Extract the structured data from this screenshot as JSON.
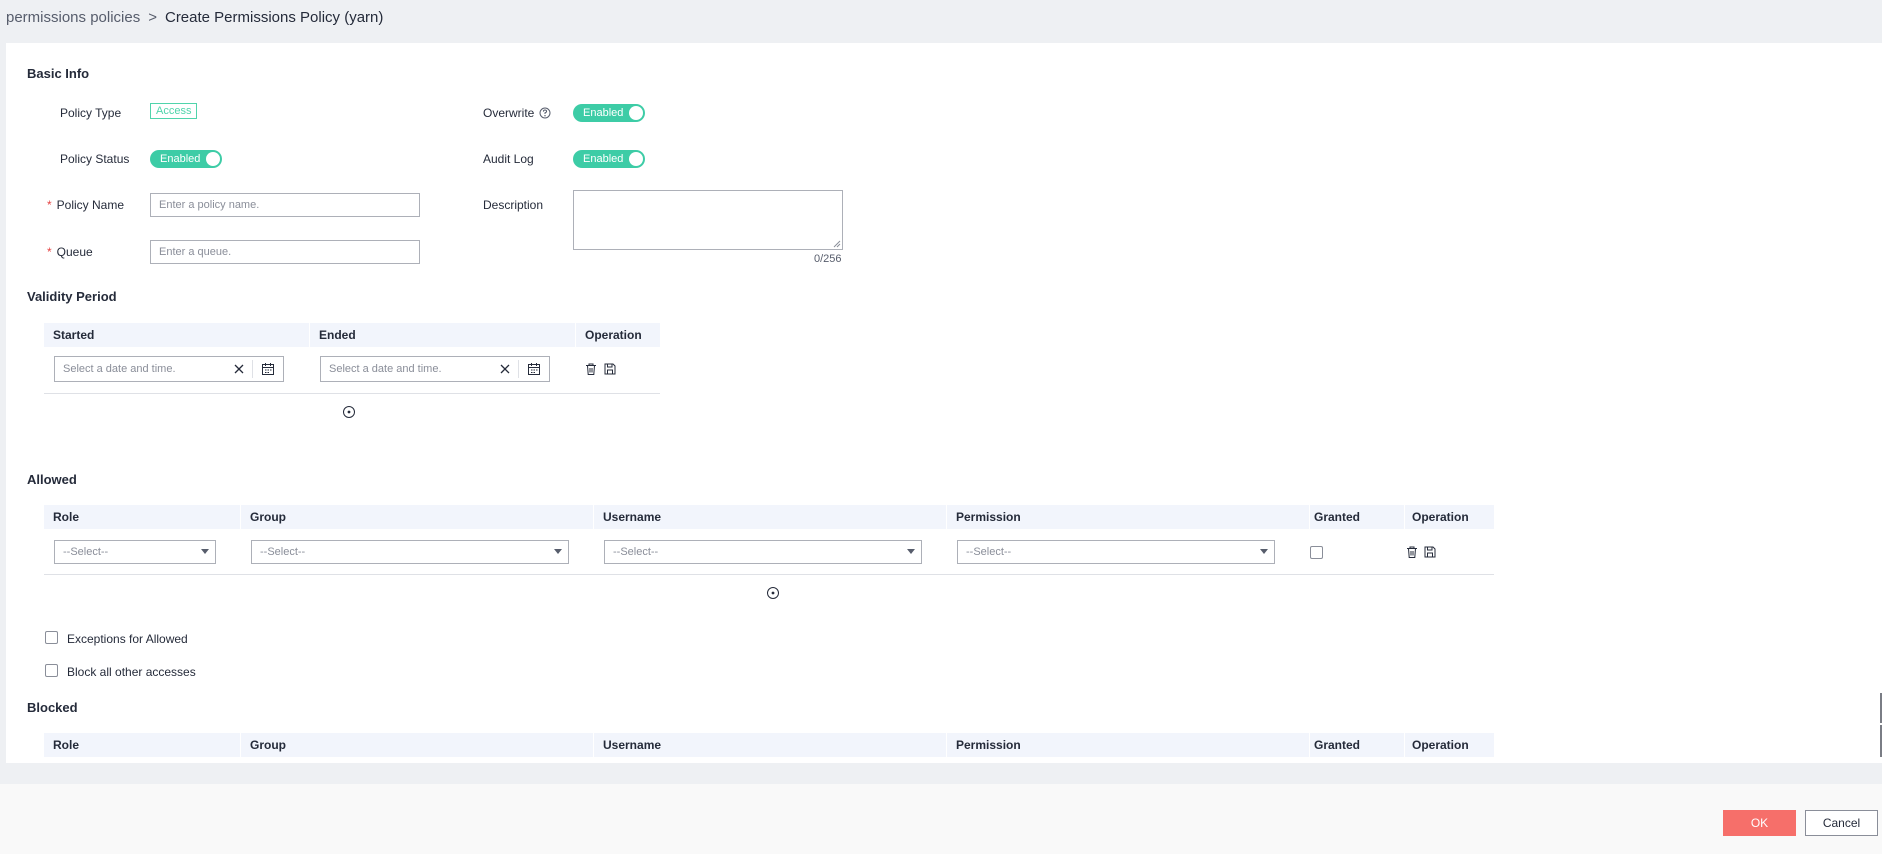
{
  "breadcrumb": {
    "parent": "permissions policies",
    "separator": ">",
    "current": "Create Permissions Policy  (yarn)"
  },
  "basic_info": {
    "title": "Basic Info",
    "policy_type_label": "Policy Type",
    "policy_type_value": "Access",
    "overwrite_label": "Overwrite",
    "overwrite_value": "Enabled",
    "policy_status_label": "Policy Status",
    "policy_status_value": "Enabled",
    "audit_log_label": "Audit Log",
    "audit_log_value": "Enabled",
    "policy_name_label": "Policy Name",
    "policy_name_placeholder": "Enter a policy name.",
    "description_label": "Description",
    "description_counter": "0/256",
    "queue_label": "Queue",
    "queue_placeholder": "Enter a queue.",
    "required_mark": "*"
  },
  "validity": {
    "title": "Validity Period",
    "columns": [
      "Started",
      "Ended",
      "Operation"
    ],
    "start_placeholder": "Select a date and time.",
    "end_placeholder": "Select a date and time."
  },
  "allowed": {
    "title": "Allowed",
    "columns": [
      "Role",
      "Group",
      "Username",
      "Permission",
      "Granted",
      "Operation"
    ],
    "select_placeholder": "--Select--"
  },
  "options": {
    "exceptions_label": "Exceptions for Allowed",
    "block_label": "Block all other accesses"
  },
  "blocked": {
    "title": "Blocked",
    "columns": [
      "Role",
      "Group",
      "Username",
      "Permission",
      "Granted",
      "Operation"
    ]
  },
  "footer": {
    "ok_label": "OK",
    "cancel_label": "Cancel"
  },
  "colors": {
    "accent_green": "#3dcca6",
    "ok_button": "#f66f6a",
    "table_header_bg": "#f2f5fc"
  }
}
